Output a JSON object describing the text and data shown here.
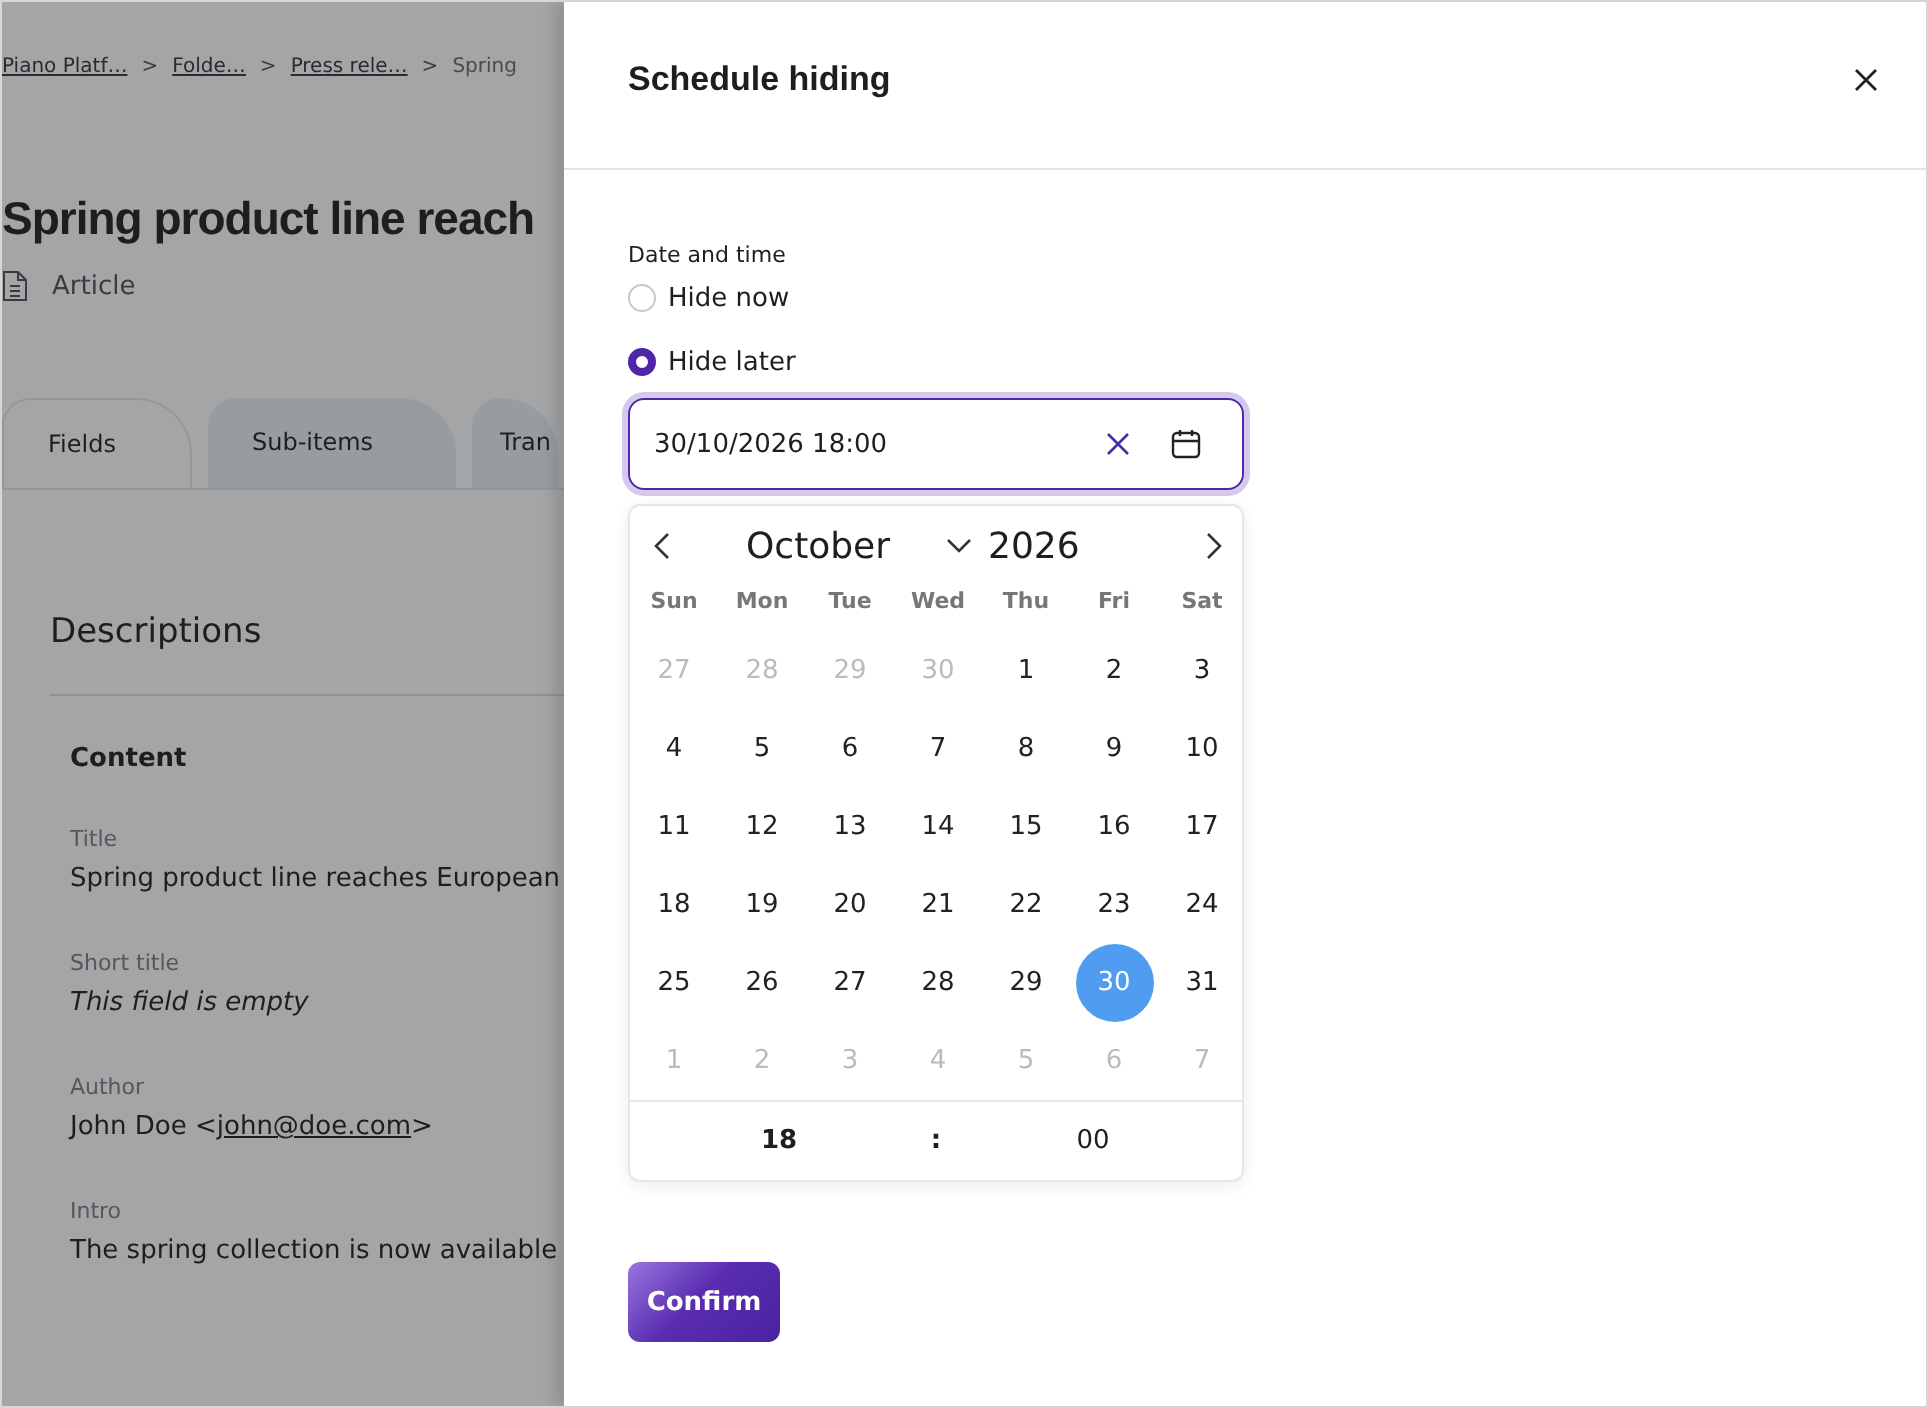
{
  "breadcrumb": [
    {
      "label": "Piano Platf…",
      "link": true
    },
    {
      "separator": ">",
      "label": "Folde…",
      "link": true
    },
    {
      "separator": ">",
      "label": "Press rele…",
      "link": true
    },
    {
      "separator": ">",
      "label": "Spring",
      "link": false
    }
  ],
  "page_title": "Spring product line reach",
  "content_type": "Article",
  "tabs": [
    {
      "label": "Fields",
      "selected": true
    },
    {
      "label": "Sub-items",
      "selected": false
    },
    {
      "label": "Tran",
      "selected": false
    }
  ],
  "section_title": "Descriptions",
  "group_title": "Content",
  "fields": [
    {
      "label": "Title",
      "value": "Spring product line reaches European",
      "empty": false
    },
    {
      "label": "Short title",
      "value": "This field is empty",
      "empty": true
    },
    {
      "label": "Author",
      "value": "John Doe <",
      "email": "john@doe.com",
      "value_end": ">",
      "empty": false
    },
    {
      "label": "Intro",
      "value": "The spring collection is now available",
      "empty": false
    }
  ],
  "drawer": {
    "title": "Schedule hiding",
    "field_label": "Date and time",
    "options": [
      {
        "label": "Hide now",
        "selected": false
      },
      {
        "label": "Hide later",
        "selected": true
      }
    ],
    "date_value": "30/10/2026 18:00",
    "calendar": {
      "month": "October",
      "year": "2026",
      "weekdays": [
        "Sun",
        "Mon",
        "Tue",
        "Wed",
        "Thu",
        "Fri",
        "Sat"
      ],
      "days": [
        {
          "label": "27",
          "outside": true,
          "selected": false
        },
        {
          "label": "28",
          "outside": true,
          "selected": false
        },
        {
          "label": "29",
          "outside": true,
          "selected": false
        },
        {
          "label": "30",
          "outside": true,
          "selected": false
        },
        {
          "label": "1",
          "outside": false,
          "selected": false
        },
        {
          "label": "2",
          "outside": false,
          "selected": false
        },
        {
          "label": "3",
          "outside": false,
          "selected": false
        },
        {
          "label": "4",
          "outside": false,
          "selected": false
        },
        {
          "label": "5",
          "outside": false,
          "selected": false
        },
        {
          "label": "6",
          "outside": false,
          "selected": false
        },
        {
          "label": "7",
          "outside": false,
          "selected": false
        },
        {
          "label": "8",
          "outside": false,
          "selected": false
        },
        {
          "label": "9",
          "outside": false,
          "selected": false
        },
        {
          "label": "10",
          "outside": false,
          "selected": false
        },
        {
          "label": "11",
          "outside": false,
          "selected": false
        },
        {
          "label": "12",
          "outside": false,
          "selected": false
        },
        {
          "label": "13",
          "outside": false,
          "selected": false
        },
        {
          "label": "14",
          "outside": false,
          "selected": false
        },
        {
          "label": "15",
          "outside": false,
          "selected": false
        },
        {
          "label": "16",
          "outside": false,
          "selected": false
        },
        {
          "label": "17",
          "outside": false,
          "selected": false
        },
        {
          "label": "18",
          "outside": false,
          "selected": false
        },
        {
          "label": "19",
          "outside": false,
          "selected": false
        },
        {
          "label": "20",
          "outside": false,
          "selected": false
        },
        {
          "label": "21",
          "outside": false,
          "selected": false
        },
        {
          "label": "22",
          "outside": false,
          "selected": false
        },
        {
          "label": "23",
          "outside": false,
          "selected": false
        },
        {
          "label": "24",
          "outside": false,
          "selected": false
        },
        {
          "label": "25",
          "outside": false,
          "selected": false
        },
        {
          "label": "26",
          "outside": false,
          "selected": false
        },
        {
          "label": "27",
          "outside": false,
          "selected": false
        },
        {
          "label": "28",
          "outside": false,
          "selected": false
        },
        {
          "label": "29",
          "outside": false,
          "selected": false
        },
        {
          "label": "30",
          "outside": false,
          "selected": true
        },
        {
          "label": "31",
          "outside": false,
          "selected": false
        },
        {
          "label": "1",
          "outside": true,
          "selected": false
        },
        {
          "label": "2",
          "outside": true,
          "selected": false
        },
        {
          "label": "3",
          "outside": true,
          "selected": false
        },
        {
          "label": "4",
          "outside": true,
          "selected": false
        },
        {
          "label": "5",
          "outside": true,
          "selected": false
        },
        {
          "label": "6",
          "outside": true,
          "selected": false
        },
        {
          "label": "7",
          "outside": true,
          "selected": false
        }
      ],
      "hour": "18",
      "separator": ":",
      "minute": "00"
    },
    "confirm": "Confirm"
  }
}
